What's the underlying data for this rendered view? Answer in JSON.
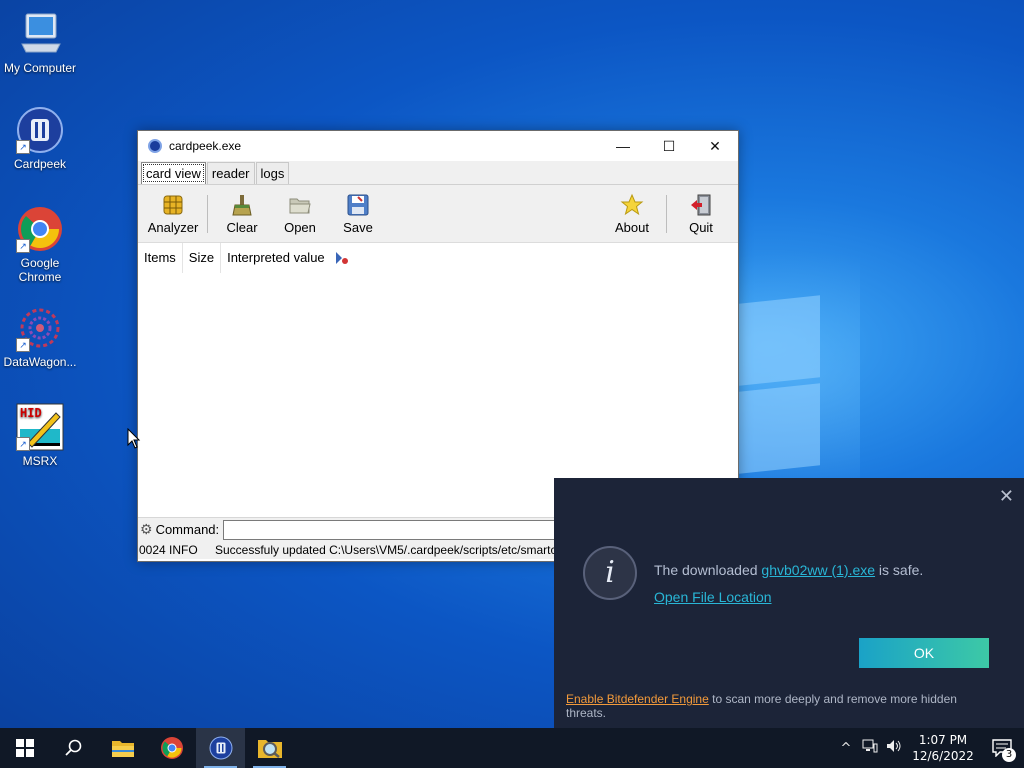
{
  "desktop": {
    "icons": [
      {
        "label": "My Computer"
      },
      {
        "label": "Cardpeek"
      },
      {
        "label": "Google Chrome"
      },
      {
        "label": "DataWagon..."
      },
      {
        "label": "MSRX"
      }
    ]
  },
  "window": {
    "title": "cardpeek.exe",
    "controls": {
      "minimize": "—",
      "maximize": "☐",
      "close": "✕"
    },
    "tabs": [
      {
        "label": "card view",
        "active": true
      },
      {
        "label": "reader",
        "active": false
      },
      {
        "label": "logs",
        "active": false
      }
    ],
    "toolbar": {
      "analyzer": "Analyzer",
      "clear": "Clear",
      "open": "Open",
      "save": "Save",
      "about": "About",
      "quit": "Quit"
    },
    "columns": {
      "items": "Items",
      "size": "Size",
      "interpreted": "Interpreted value"
    },
    "command": {
      "label": "Command:",
      "value": ""
    },
    "status": {
      "level": "0024 INFO",
      "message": "Successfuly updated C:\\Users\\VM5/.cardpeek/scripts/etc/smartcard_list.txt"
    }
  },
  "notification": {
    "close": "✕",
    "info_glyph": "i",
    "message_prefix": "The downloaded ",
    "file_link": "ghvb02ww (1).exe",
    "message_suffix": " is safe.",
    "open_location": "Open File Location",
    "ok": "OK",
    "footer_link": "Enable Bitdefender Engine",
    "footer_text": " to scan more deeply and remove more hidden threats."
  },
  "taskbar": {
    "clock_time": "1:07 PM",
    "clock_date": "12/6/2022",
    "notification_count": "3",
    "tray_chevron": "^"
  },
  "colors": {
    "taskbar_bg": "#101826",
    "notify_bg": "#1c2438",
    "link": "#29b6d6",
    "footer_link": "#f29a3b"
  }
}
